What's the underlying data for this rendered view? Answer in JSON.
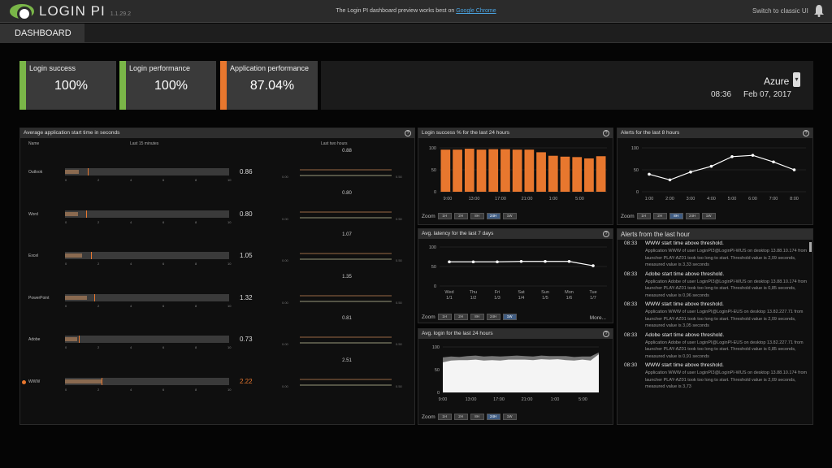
{
  "header": {
    "brand": "LOGIN PI",
    "version": "1.1.29.2",
    "notice_prefix": "The Login PI dashboard preview works best on",
    "notice_link": "Google Chrome",
    "switch_label": "Switch to classic UI"
  },
  "nav": {
    "tab": "DASHBOARD"
  },
  "kpis": [
    {
      "label": "Login success",
      "value": "100%",
      "color": "#7ab648"
    },
    {
      "label": "Login performance",
      "value": "100%",
      "color": "#7ab648"
    },
    {
      "label": "Application performance",
      "value": "87.04%",
      "color": "#e8772e"
    }
  ],
  "environment": {
    "name": "Azure",
    "time": "08:36",
    "date": "Feb 07, 2017"
  },
  "app_panel": {
    "title": "Average application start time in seconds",
    "col_name": "Name",
    "col_last15": "Last 15 minutes",
    "col_last2h": "Last two hours",
    "ticks": [
      "0",
      "2",
      "4",
      "6",
      "8",
      "10"
    ],
    "spark_axis": [
      "0.00",
      "0.50"
    ],
    "apps": [
      {
        "name": "Outlook",
        "value": "0.86",
        "peak": "0.88",
        "fill": 0.086,
        "marker": 0.14,
        "alert": false
      },
      {
        "name": "Word",
        "value": "0.80",
        "peak": "0.80",
        "fill": 0.08,
        "marker": 0.13,
        "alert": false
      },
      {
        "name": "Excel",
        "value": "1.05",
        "peak": "1.07",
        "fill": 0.105,
        "marker": 0.16,
        "alert": false
      },
      {
        "name": "PowerPoint",
        "value": "1.32",
        "peak": "1.35",
        "fill": 0.132,
        "marker": 0.18,
        "alert": false
      },
      {
        "name": "Adobe",
        "value": "0.73",
        "peak": "0.81",
        "fill": 0.073,
        "marker": 0.085,
        "alert": false
      },
      {
        "name": "WWW",
        "value": "2.22",
        "peak": "2.51",
        "fill": 0.222,
        "marker": 0.222,
        "alert": true
      }
    ]
  },
  "zoom_label": "Zoom",
  "more_label": "More...",
  "login_success": {
    "title": "Login success % for the last 24 hours",
    "zoom": [
      "1H",
      "2H",
      "8H",
      "24H",
      "1W"
    ],
    "zoom_active": "24H"
  },
  "alerts_chart": {
    "title": "Alerts for the last 8 hours",
    "zoom": [
      "1H",
      "2H",
      "8H",
      "24H",
      "1W"
    ],
    "zoom_active": "8H"
  },
  "latency": {
    "title": "Avg. latency for the last 7 days",
    "zoom": [
      "1H",
      "2H",
      "8H",
      "24H",
      "1W"
    ],
    "zoom_active": "1W"
  },
  "avg_login": {
    "title": "Avg. login for the last 24 hours",
    "zoom": [
      "1H",
      "2H",
      "8H",
      "24H",
      "1W"
    ],
    "zoom_active": "24H"
  },
  "chart_data": [
    {
      "type": "bar",
      "title": "Login success % for the last 24 hours",
      "x_ticks": [
        "9:00",
        "13:00",
        "17:00",
        "21:00",
        "1:00",
        "5:00"
      ],
      "y_ticks": [
        "0",
        "50",
        "100"
      ],
      "ylim": [
        0,
        100
      ],
      "values": [
        96,
        96,
        98,
        96,
        97,
        97,
        96,
        96,
        90,
        82,
        80,
        79,
        76,
        81
      ],
      "color": "#e8772e",
      "grid": true
    },
    {
      "type": "line",
      "title": "Alerts for the last 8 hours",
      "x_ticks": [
        "1:00",
        "2:00",
        "3:00",
        "4:00",
        "5:00",
        "6:00",
        "7:00",
        "8:00"
      ],
      "y_ticks": [
        "0",
        "50",
        "100"
      ],
      "ylim": [
        0,
        100
      ],
      "values": [
        40,
        27,
        45,
        58,
        80,
        83,
        68,
        50
      ],
      "grid": true
    },
    {
      "type": "line",
      "title": "Avg. latency for the last 7 days",
      "x_ticks": [
        [
          "Wed",
          "1/1"
        ],
        [
          "Thu",
          "1/2"
        ],
        [
          "Fri",
          "1/3"
        ],
        [
          "Sat",
          "1/4"
        ],
        [
          "Sun",
          "1/5"
        ],
        [
          "Mon",
          "1/6"
        ],
        [
          "Tue",
          "1/7"
        ]
      ],
      "y_ticks": [
        "0",
        "50",
        "100"
      ],
      "ylim": [
        0,
        100
      ],
      "values": [
        62,
        62,
        62,
        63,
        63,
        63,
        52
      ],
      "grid": true
    },
    {
      "type": "area",
      "title": "Avg. login for the last 24 hours",
      "x_ticks": [
        "9:00",
        "13:00",
        "17:00",
        "21:00",
        "1:00",
        "5:00"
      ],
      "y_ticks": [
        "0",
        "50",
        "100"
      ],
      "ylim": [
        0,
        100
      ],
      "values": [
        66,
        70,
        71,
        71,
        72,
        70,
        71,
        70,
        72,
        72,
        72,
        71,
        73,
        72,
        73,
        71,
        70,
        72,
        70,
        84
      ],
      "upper": [
        77,
        79,
        78,
        80,
        81,
        79,
        80,
        79,
        80,
        81,
        80,
        79,
        81,
        80,
        80,
        80,
        78,
        79,
        79,
        88
      ],
      "grid": true
    }
  ],
  "alerts_panel": {
    "title": "Alerts from the last hour",
    "items": [
      {
        "time": "08:33",
        "title": "WWW start time above threshold.",
        "detail": "Application WWW of user LoginPI3@LoginPI-WUS on desktop 13.88.10.174 from launcher PLAY-AZ01 took too long to start. Threshold value is 2,09 seconds, measured value is 3,33 seconds"
      },
      {
        "time": "08:33",
        "title": "Adobe start time above threshold.",
        "detail": "Application Adobe of user LoginPI3@LoginPI-WUS on desktop 13.88.10.174 from launcher PLAY-AZ01 took too long to start. Threshold value is 0,85 seconds, measured value is 0,96 seconds"
      },
      {
        "time": "08:33",
        "title": "WWW start time above threshold.",
        "detail": "Application WWW of user LoginPI@LoginPI-EUS on desktop 13.82.227.71 from launcher PLAY-AZ01 took too long to start. Threshold value is 2,09 seconds, measured value is 3,05 seconds"
      },
      {
        "time": "08:33",
        "title": "Adobe start time above threshold.",
        "detail": "Application Adobe of user LoginPI@LoginPI-EUS on desktop 13.82.227.71 from launcher PLAY-AZ01 took too long to start. Threshold value is 0,85 seconds, measured value is 0,91 seconds"
      },
      {
        "time": "08:30",
        "title": "WWW start time above threshold.",
        "detail": "Application WWW of user LoginPI3@LoginPI-WUS on desktop 13.88.10.174 from launcher PLAY-AZ01 took too long to start. Threshold value is 2,09 seconds, measured value is 3,73"
      }
    ]
  }
}
